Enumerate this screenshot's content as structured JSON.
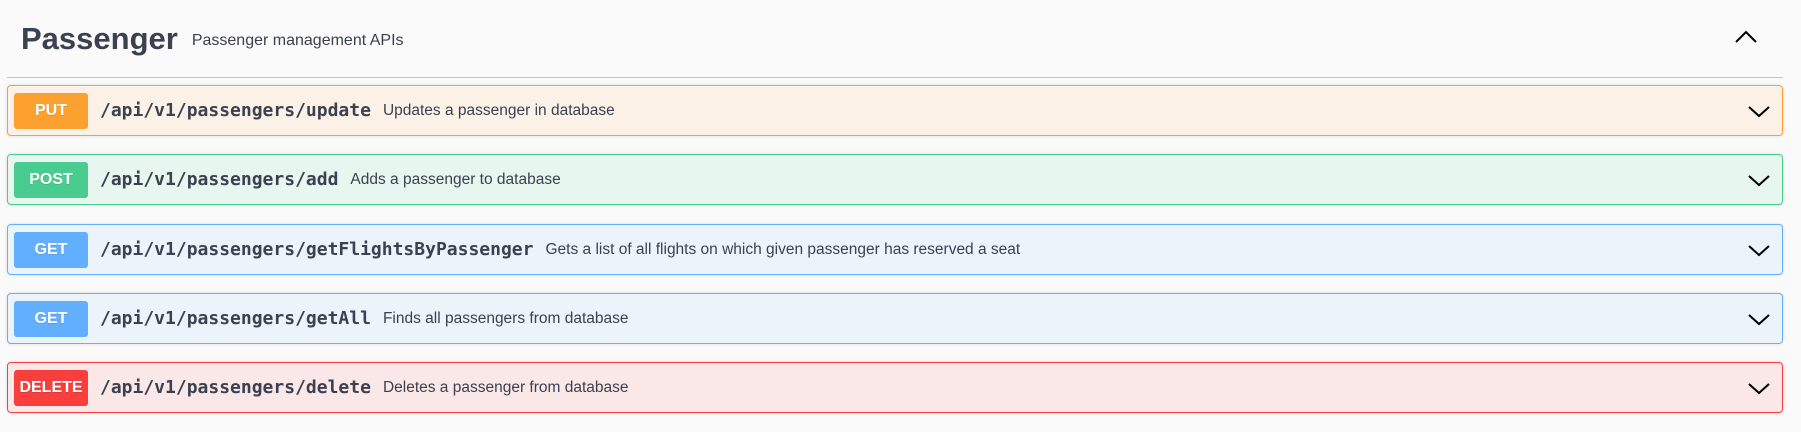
{
  "tag": {
    "title": "Passenger",
    "description": "Passenger management APIs",
    "toggle_icon": "chevron-up-icon"
  },
  "operations": [
    {
      "method": "PUT",
      "path": "/api/v1/passengers/update",
      "summary": "Updates a passenger in database",
      "color": "#fca130",
      "bg": "#fcf1e7"
    },
    {
      "method": "POST",
      "path": "/api/v1/passengers/add",
      "summary": "Adds a passenger to database",
      "color": "#49cc90",
      "bg": "#e7f6ef"
    },
    {
      "method": "GET",
      "path": "/api/v1/passengers/getFlightsByPassenger",
      "summary": "Gets a list of all flights on which given passenger has reserved a seat",
      "color": "#61affe",
      "bg": "#ebf3fb"
    },
    {
      "method": "GET",
      "path": "/api/v1/passengers/getAll",
      "summary": "Finds all passengers from database",
      "color": "#61affe",
      "bg": "#ebf3fb"
    },
    {
      "method": "DELETE",
      "path": "/api/v1/passengers/delete",
      "summary": "Deletes a passenger from database",
      "color": "#f93e3e",
      "bg": "#fae7e7"
    }
  ]
}
